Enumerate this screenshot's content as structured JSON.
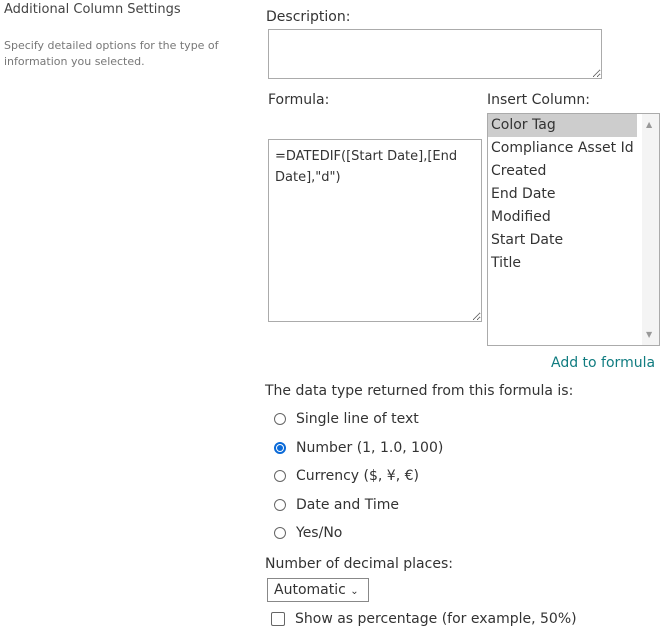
{
  "section": {
    "title": "Additional Column Settings",
    "description": "Specify detailed options for the type of information you selected."
  },
  "description_label": "Description:",
  "description_value": "",
  "formula_label": "Formula:",
  "formula_value": "=DATEDIF([Start Date],[End Date],\"d\")",
  "insert_column_label": "Insert Column:",
  "columns": [
    "Color Tag",
    "Compliance Asset Id",
    "Created",
    "End Date",
    "Modified",
    "Start Date",
    "Title"
  ],
  "add_to_formula": "Add to formula",
  "data_type_label": "The data type returned from this formula is:",
  "data_types": [
    {
      "label": "Single line of text",
      "checked": false
    },
    {
      "label": "Number (1, 1.0, 100)",
      "checked": true
    },
    {
      "label": "Currency ($, ¥, €)",
      "checked": false
    },
    {
      "label": "Date and Time",
      "checked": false
    },
    {
      "label": "Yes/No",
      "checked": false
    }
  ],
  "decimal_label": "Number of decimal places:",
  "decimal_value": "Automatic",
  "percentage_label": "Show as percentage (for example, 50%)",
  "accent": "#0b6ad8"
}
